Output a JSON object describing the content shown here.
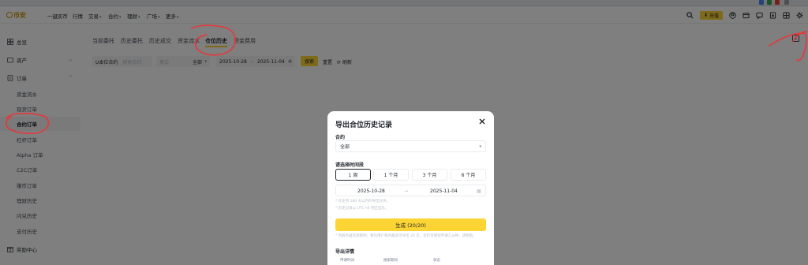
{
  "topnav": {
    "logo": "币安",
    "items": [
      {
        "label": "一键买币",
        "caret": false
      },
      {
        "label": "行情",
        "caret": false
      },
      {
        "label": "交易",
        "caret": true
      },
      {
        "label": "合约",
        "caret": true
      },
      {
        "label": "理财",
        "caret": true
      },
      {
        "label": "广场",
        "caret": true
      },
      {
        "label": "更多",
        "caret": true
      }
    ],
    "deposit_label": "充值"
  },
  "sidebar": {
    "items": [
      {
        "label": "总览",
        "icon": "grid-icon",
        "level": "top"
      },
      {
        "label": "资产",
        "icon": "wallet-icon",
        "level": "top",
        "chevron": "down"
      },
      {
        "label": "订单",
        "icon": "order-icon",
        "level": "top",
        "chevron": "up"
      },
      {
        "label": "资金流水",
        "level": "sub"
      },
      {
        "label": "现货订单",
        "level": "sub"
      },
      {
        "label": "合约订单",
        "level": "sub",
        "active": true
      },
      {
        "label": "杠杆订单",
        "level": "sub"
      },
      {
        "label": "Alpha 订单",
        "level": "sub"
      },
      {
        "label": "C2C订单",
        "level": "sub"
      },
      {
        "label": "赚币订单",
        "level": "sub"
      },
      {
        "label": "理财历史",
        "level": "sub"
      },
      {
        "label": "闪兑历史",
        "level": "sub"
      },
      {
        "label": "支付历史",
        "level": "sub"
      },
      {
        "label": "奖励中心",
        "icon": "reward-icon",
        "level": "top"
      }
    ]
  },
  "tabs": [
    {
      "label": "当前委托"
    },
    {
      "label": "历史委托"
    },
    {
      "label": "历史成交"
    },
    {
      "label": "资金流水"
    },
    {
      "label": "仓位历史",
      "active": true
    },
    {
      "label": "资金费用"
    }
  ],
  "filters": {
    "contract_type": "U本位合约",
    "contract_search_placeholder": "搜索合约",
    "mode_label": "模式",
    "mode_value": "全部",
    "date_start": "2025-10-28",
    "date_end": "2025-11-04",
    "search_label": "搜索",
    "reset_label": "重置",
    "refresh_label": "刷新"
  },
  "modal": {
    "title": "导出合位历史记录",
    "contract_label": "合约",
    "contract_value": "全部",
    "range_label": "请选择时间段",
    "ranges": [
      "1 周",
      "1 个月",
      "3 个月",
      "6 个月"
    ],
    "date_start": "2025-10-28",
    "date_end": "2025-11-04",
    "hint_1": "* 仅支持 180 天以内的导出文件。",
    "hint_2": "* 历史记录以 UTC+8 时区显示。",
    "generate_label": "生成 (20/20)",
    "generate_hint": "* 因服务器资源限制，每位用户每月最多可导出 20 次，您仍可继续申请几分钟，请稍后。",
    "details_label": "导出详情",
    "table_headers": [
      "申请时间",
      "搜索期间",
      "状态"
    ]
  },
  "colors": {
    "accent": "#fcd535",
    "annotation": "#e8363b"
  }
}
